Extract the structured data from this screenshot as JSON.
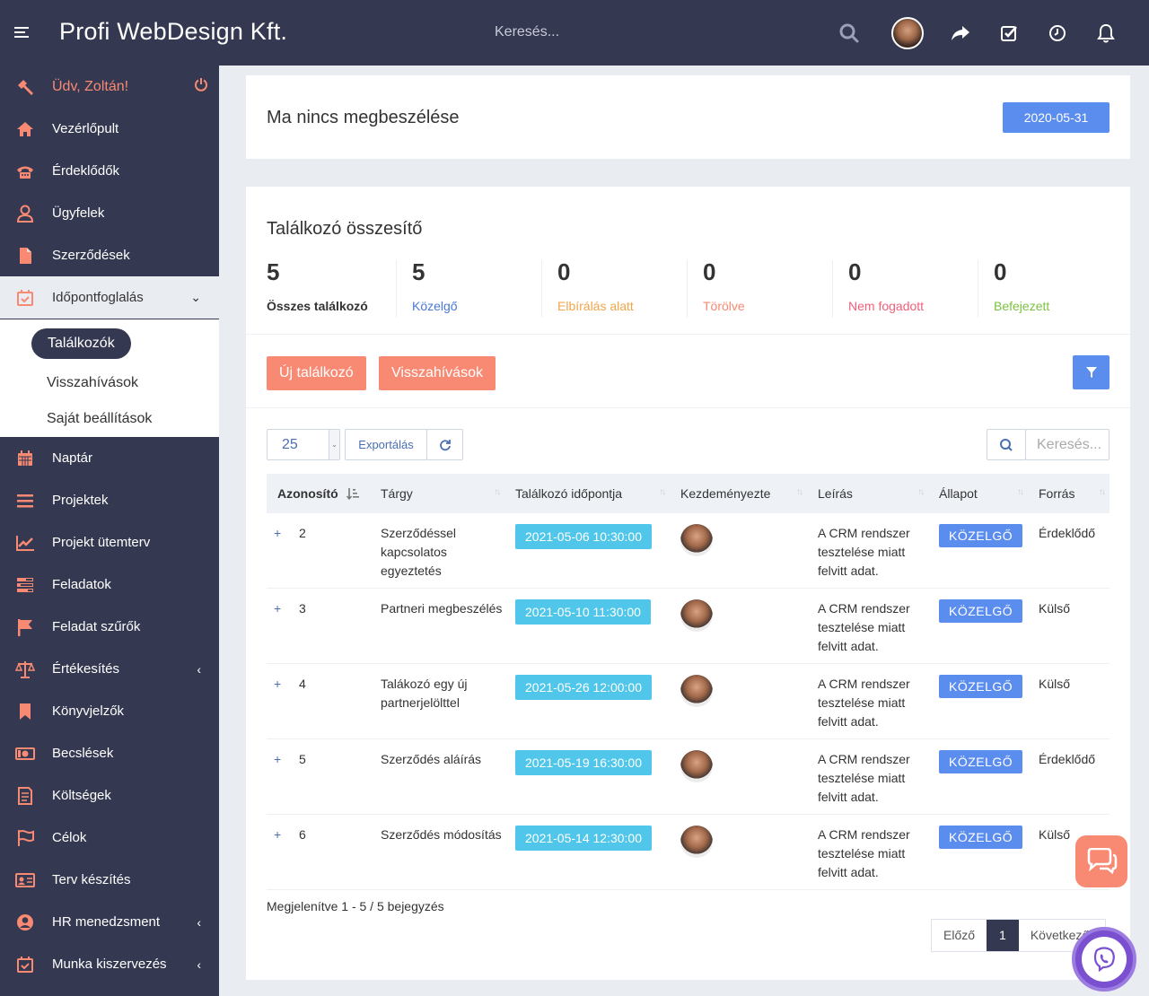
{
  "header": {
    "brand": "Profi WebDesign Kft.",
    "search_placeholder": "Keresés...",
    "icons": [
      "menu-icon",
      "search-icon",
      "avatar",
      "share-icon",
      "checklist-icon",
      "clock-icon",
      "bell-icon"
    ]
  },
  "sidebar": {
    "greeting": "Üdv, Zoltán!",
    "items": [
      {
        "label": "Vezérlőpult",
        "icon": "home-icon"
      },
      {
        "label": "Érdeklődők",
        "icon": "phone-icon"
      },
      {
        "label": "Ügyfelek",
        "icon": "user-icon"
      },
      {
        "label": "Szerződések",
        "icon": "file-icon"
      },
      {
        "label": "Időpontfoglalás",
        "icon": "calendar-check-icon",
        "arrow": "⌄"
      },
      {
        "label": "Naptár",
        "icon": "calendar-icon"
      },
      {
        "label": "Projektek",
        "icon": "bars-icon"
      },
      {
        "label": "Projekt ütemterv",
        "icon": "chart-line-icon"
      },
      {
        "label": "Feladatok",
        "icon": "tasks-icon"
      },
      {
        "label": "Feladat szűrők",
        "icon": "flag-icon"
      },
      {
        "label": "Értékesítés",
        "icon": "balance-icon",
        "arrow": "‹"
      },
      {
        "label": "Könyvjelzők",
        "icon": "bookmark-icon"
      },
      {
        "label": "Becslések",
        "icon": "money-icon"
      },
      {
        "label": "Költségek",
        "icon": "receipt-icon"
      },
      {
        "label": "Célok",
        "icon": "flag-outline-icon"
      },
      {
        "label": "Terv készítés",
        "icon": "id-card-icon"
      },
      {
        "label": "HR menedzsment",
        "icon": "user-circle-icon",
        "arrow": "‹"
      },
      {
        "label": "Munka kiszervezés",
        "icon": "calendar-check-icon",
        "arrow": "‹"
      }
    ],
    "sub": {
      "active": "Találkozók",
      "items": [
        "Visszahívások",
        "Saját beállítások"
      ]
    }
  },
  "notice": {
    "text": "Ma nincs megbeszélése",
    "date": "2020-05-31"
  },
  "summary": {
    "title": "Találkozó összesítő",
    "stats": [
      {
        "value": "5",
        "label": "Összes találkozó",
        "color": "#333333"
      },
      {
        "value": "5",
        "label": "Közelgő",
        "color": "#4a78d6"
      },
      {
        "value": "0",
        "label": "Elbírálás alatt",
        "color": "#f0a64a"
      },
      {
        "value": "0",
        "label": "Törölve",
        "color": "#f88a73"
      },
      {
        "value": "0",
        "label": "Nem fogadott",
        "color": "#f0607a"
      },
      {
        "value": "0",
        "label": "Befejezett",
        "color": "#7cc242"
      }
    ]
  },
  "actions": {
    "new": "Új találkozó",
    "callbacks": "Visszahívások"
  },
  "table_controls": {
    "page_size": "25",
    "export": "Exportálás",
    "search_placeholder": "Keresés..."
  },
  "table": {
    "headers": [
      "Azonosító",
      "Tárgy",
      "Találkozó időpontja",
      "Kezdeményezte",
      "Leírás",
      "Állapot",
      "Forrás"
    ],
    "rows": [
      {
        "id": "2",
        "subject": "Szerződéssel kapcsolatos egyeztetés",
        "time": "2021-05-06 10:30:00",
        "desc": "A CRM rendszer tesztelése miatt felvitt adat.",
        "status": "KÖZELGŐ",
        "source": "Érdeklődő"
      },
      {
        "id": "3",
        "subject": "Partneri megbeszélés",
        "time": "2021-05-10 11:30:00",
        "desc": "A CRM rendszer tesztelése miatt felvitt adat.",
        "status": "KÖZELGŐ",
        "source": "Külső"
      },
      {
        "id": "4",
        "subject": "Talákozó egy új partnerjelölttel",
        "time": "2021-05-26 12:00:00",
        "desc": "A CRM rendszer tesztelése miatt felvitt adat.",
        "status": "KÖZELGŐ",
        "source": "Külső"
      },
      {
        "id": "5",
        "subject": "Szerződés aláírás",
        "time": "2021-05-19 16:30:00",
        "desc": "A CRM rendszer tesztelése miatt felvitt adat.",
        "status": "KÖZELGŐ",
        "source": "Érdeklődő"
      },
      {
        "id": "6",
        "subject": "Szerződés módosítás",
        "time": "2021-05-14 12:30:00",
        "desc": "A CRM rendszer tesztelése miatt felvitt adat.",
        "status": "KÖZELGŐ",
        "source": "Külső"
      }
    ]
  },
  "footer": {
    "info": "Megjelenítve 1 - 5 / 5 bejegyzés",
    "prev": "Előző",
    "page": "1",
    "next": "Következő"
  },
  "colors": {
    "accent": "#f88a73",
    "sidebar": "#343850",
    "primary": "#5b8def",
    "info": "#4fc6ea"
  }
}
